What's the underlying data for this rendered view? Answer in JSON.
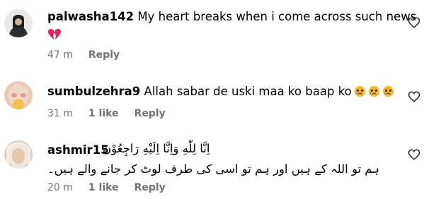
{
  "comments": [
    {
      "username": "palwasha142",
      "text": "My heart breaks when i come across such news",
      "emoji": "broken-heart",
      "time": "47 m",
      "likes": "",
      "reply_label": "Reply"
    },
    {
      "username": "sumbulzehra9",
      "text": "Allah sabar de uski maa ko baap ko",
      "emoji": "crying-face x3",
      "time": "31 m",
      "likes": "1 like",
      "reply_label": "Reply"
    },
    {
      "username": "ashmir15",
      "text_inline": "اِنَّا لِلّٰهِ وَاِنَّا اِلَيْهِ رَاجِعُوْنَ",
      "text_second_line": "ہم تو اللہ کے ہیں اور ہم تو اسی کی طرف لوٹ کر جانے والے ہیں۔",
      "time": "20 m",
      "likes": "1 like",
      "reply_label": "Reply"
    }
  ],
  "icons": {
    "like": "heart-outline-icon",
    "broken_heart": "broken-heart-emoji",
    "crying": "crying-face-emoji"
  },
  "colors": {
    "meta_text": "#737373",
    "broken_heart": "#e0245e",
    "emoji_face": "#f5b82e"
  }
}
